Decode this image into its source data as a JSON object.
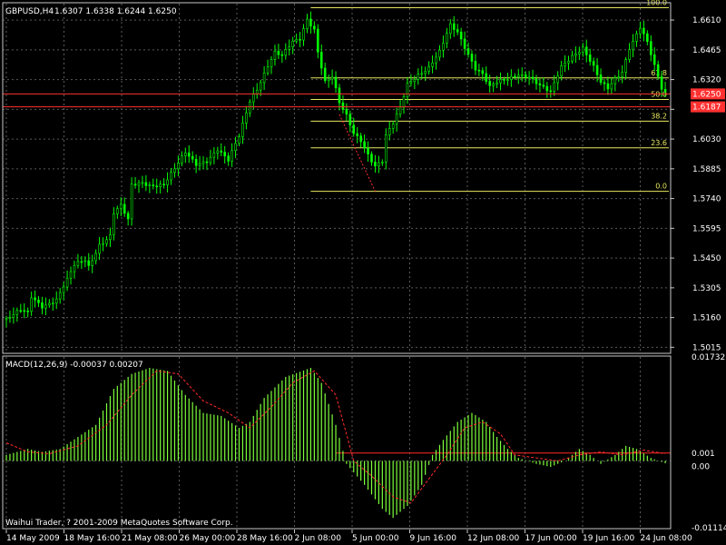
{
  "chart_data": [
    {
      "type": "candlestick",
      "title": "GBPUSD,H4",
      "ohlc_readout": "1.6307 1.6338 1.6244 1.6250",
      "bid": "1.6250",
      "ask": "1.6187",
      "ylim": [
        1.499,
        1.669
      ],
      "yticks": [
        "1.6610",
        "1.6465",
        "1.6320",
        "1.6175",
        "1.6030",
        "1.5885",
        "1.5740",
        "1.5595",
        "1.5450",
        "1.5305",
        "1.5160",
        "1.5015"
      ],
      "xticks": [
        "14 May 2009",
        "18 May 16:00",
        "21 May 08:00",
        "26 May 00:00",
        "28 May 16:00",
        "2 Jun 08:00",
        "5 Jun 00:00",
        "9 Jun 16:00",
        "12 Jun 08:00",
        "17 Jun 00:00",
        "19 Jun 16:00",
        "24 Jun 08:00"
      ],
      "grid": true,
      "close_path": [
        [
          0,
          1.515
        ],
        [
          4,
          1.519
        ],
        [
          6,
          1.518
        ],
        [
          7,
          1.526
        ],
        [
          10,
          1.522
        ],
        [
          14,
          1.525
        ],
        [
          17,
          1.534
        ],
        [
          19,
          1.541
        ],
        [
          22,
          1.544
        ],
        [
          23,
          1.541
        ],
        [
          26,
          1.552
        ],
        [
          29,
          1.556
        ],
        [
          30,
          1.567
        ],
        [
          32,
          1.57
        ],
        [
          34,
          1.563
        ],
        [
          35,
          1.58
        ],
        [
          38,
          1.582
        ],
        [
          40,
          1.581
        ],
        [
          44,
          1.581
        ],
        [
          47,
          1.588
        ],
        [
          50,
          1.596
        ],
        [
          53,
          1.591
        ],
        [
          56,
          1.593
        ],
        [
          59,
          1.598
        ],
        [
          62,
          1.592
        ],
        [
          65,
          1.604
        ],
        [
          68,
          1.622
        ],
        [
          70,
          1.628
        ],
        [
          73,
          1.639
        ],
        [
          75,
          1.645
        ],
        [
          77,
          1.643
        ],
        [
          80,
          1.65
        ],
        [
          82,
          1.652
        ],
        [
          84,
          1.662
        ],
        [
          86,
          1.657
        ],
        [
          87,
          1.646
        ],
        [
          89,
          1.631
        ],
        [
          91,
          1.633
        ],
        [
          93,
          1.62
        ],
        [
          95,
          1.614
        ],
        [
          97,
          1.606
        ],
        [
          99,
          1.603
        ],
        [
          101,
          1.596
        ],
        [
          103,
          1.59
        ],
        [
          105,
          1.592
        ],
        [
          106,
          1.604
        ],
        [
          108,
          1.61
        ],
        [
          110,
          1.618
        ],
        [
          112,
          1.63
        ],
        [
          115,
          1.635
        ],
        [
          118,
          1.638
        ],
        [
          121,
          1.645
        ],
        [
          124,
          1.658
        ],
        [
          126,
          1.655
        ],
        [
          129,
          1.645
        ],
        [
          131,
          1.638
        ],
        [
          133,
          1.635
        ],
        [
          135,
          1.628
        ],
        [
          137,
          1.63
        ],
        [
          140,
          1.632
        ],
        [
          143,
          1.635
        ],
        [
          146,
          1.634
        ],
        [
          149,
          1.629
        ],
        [
          152,
          1.625
        ],
        [
          155,
          1.638
        ],
        [
          158,
          1.644
        ],
        [
          161,
          1.648
        ],
        [
          164,
          1.638
        ],
        [
          166,
          1.63
        ],
        [
          168,
          1.627
        ],
        [
          170,
          1.632
        ],
        [
          172,
          1.636
        ],
        [
          174,
          1.648
        ],
        [
          177,
          1.658
        ],
        [
          179,
          1.65
        ],
        [
          181,
          1.638
        ],
        [
          183,
          1.627
        ],
        [
          184,
          1.625
        ]
      ],
      "fibonacci": {
        "start_bar": 85,
        "high": 1.667,
        "low": 1.5775,
        "levels": [
          {
            "label": "100.0",
            "value": 1.667
          },
          {
            "label": "61.8",
            "value": 1.6328
          },
          {
            "label": "50.0",
            "value": 1.6223
          },
          {
            "label": "38.2",
            "value": 1.6117
          },
          {
            "label": "23.6",
            "value": 1.5987
          },
          {
            "label": "0.0",
            "value": 1.5775
          }
        ]
      }
    },
    {
      "type": "bar",
      "title": "MACD(12,26,9) -0.00037 0.00207",
      "ylim": [
        -0.01114,
        0.01732
      ],
      "ytick_labels": [
        "0.01732",
        "0.001",
        "0.00",
        "-0.01114"
      ],
      "signal_label": "0.001",
      "histogram_path": [
        [
          0,
          0.001
        ],
        [
          6,
          0.002
        ],
        [
          10,
          0.0015
        ],
        [
          15,
          0.002
        ],
        [
          20,
          0.004
        ],
        [
          25,
          0.006
        ],
        [
          30,
          0.012
        ],
        [
          35,
          0.0145
        ],
        [
          40,
          0.0155
        ],
        [
          45,
          0.015
        ],
        [
          50,
          0.011
        ],
        [
          55,
          0.008
        ],
        [
          60,
          0.0075
        ],
        [
          65,
          0.0055
        ],
        [
          68,
          0.0065
        ],
        [
          72,
          0.0105
        ],
        [
          78,
          0.014
        ],
        [
          85,
          0.0155
        ],
        [
          88,
          0.013
        ],
        [
          92,
          0.006
        ],
        [
          95,
          -0.0005
        ],
        [
          100,
          -0.004
        ],
        [
          105,
          -0.008
        ],
        [
          108,
          -0.0095
        ],
        [
          112,
          -0.0075
        ],
        [
          116,
          -0.004
        ],
        [
          119,
          0.001
        ],
        [
          122,
          0.0035
        ],
        [
          126,
          0.0065
        ],
        [
          130,
          0.008
        ],
        [
          134,
          0.0065
        ],
        [
          137,
          0.004
        ],
        [
          140,
          0.002
        ],
        [
          143,
          0.0005
        ],
        [
          148,
          -0.0005
        ],
        [
          152,
          -0.001
        ],
        [
          156,
          0.0
        ],
        [
          160,
          0.002
        ],
        [
          163,
          0.001
        ],
        [
          166,
          -0.0005
        ],
        [
          170,
          0.001
        ],
        [
          173,
          0.0025
        ],
        [
          176,
          0.002
        ],
        [
          180,
          0.0005
        ],
        [
          184,
          -0.0004
        ]
      ],
      "signal_path": [
        [
          0,
          0.003
        ],
        [
          6,
          0.0015
        ],
        [
          12,
          0.0012
        ],
        [
          20,
          0.0025
        ],
        [
          28,
          0.006
        ],
        [
          35,
          0.011
        ],
        [
          42,
          0.015
        ],
        [
          48,
          0.0145
        ],
        [
          55,
          0.01
        ],
        [
          62,
          0.008
        ],
        [
          68,
          0.0055
        ],
        [
          74,
          0.009
        ],
        [
          80,
          0.013
        ],
        [
          86,
          0.015
        ],
        [
          92,
          0.011
        ],
        [
          97,
          0.0
        ],
        [
          102,
          -0.0025
        ],
        [
          108,
          -0.006
        ],
        [
          113,
          -0.007
        ],
        [
          118,
          -0.003
        ],
        [
          123,
          0.001
        ],
        [
          128,
          0.0055
        ],
        [
          133,
          0.0065
        ],
        [
          138,
          0.0045
        ],
        [
          142,
          0.001
        ],
        [
          148,
          0.0005
        ],
        [
          154,
          0.0
        ],
        [
          160,
          0.001
        ],
        [
          166,
          0.0015
        ],
        [
          172,
          0.001
        ],
        [
          178,
          0.0018
        ],
        [
          184,
          0.0012
        ]
      ]
    }
  ],
  "footer": {
    "copyright": "Waihui Trader, ? 2001-2009 MetaQuotes Software Corp."
  },
  "colors": {
    "background": "#000000",
    "grid": "#5a5a5a",
    "frame": "#c8c8c8",
    "candle": "#00ff00",
    "histogram": "#7cff3a",
    "signal": "#ff2a2a",
    "fib": "#e8e860",
    "price_line": "#ff3030",
    "text": "#ffffff"
  }
}
